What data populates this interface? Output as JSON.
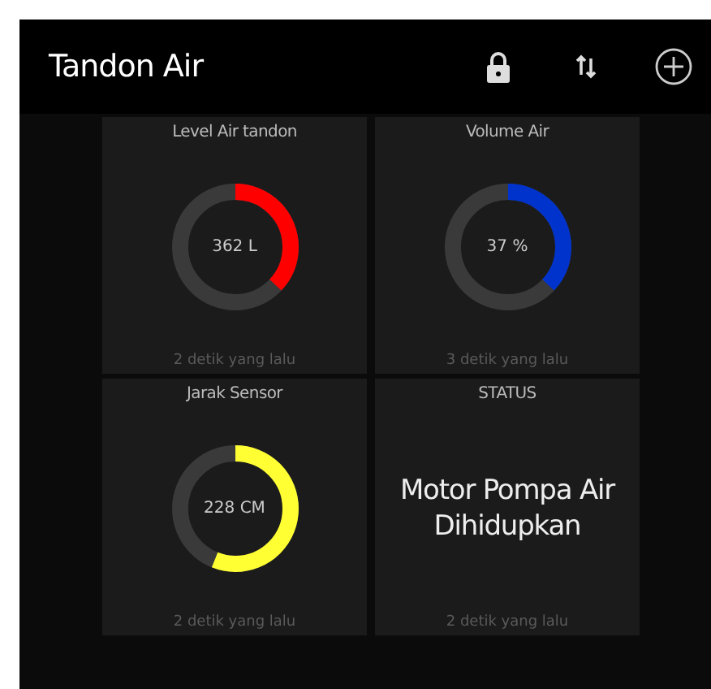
{
  "app_bar": {
    "title": "Tandon Air"
  },
  "widgets": [
    {
      "kind": "gauge",
      "title": "Level Air tandon",
      "value": "362 L",
      "level": 0.37,
      "color": "#ff0000",
      "updated": "2 detik yang lalu"
    },
    {
      "kind": "gauge",
      "title": "Volume Air",
      "value": "37 %",
      "level": 0.37,
      "color": "#0033cc",
      "updated": "3 detik yang lalu"
    },
    {
      "kind": "gauge",
      "title": "Jarak Sensor",
      "value": "228 CM",
      "level": 0.56,
      "color": "#ffff33",
      "updated": "2 detik yang lalu"
    },
    {
      "kind": "text",
      "title": "STATUS",
      "value": "Motor Pompa Air Dihidupkan",
      "updated": "2 detik yang lalu"
    }
  ]
}
